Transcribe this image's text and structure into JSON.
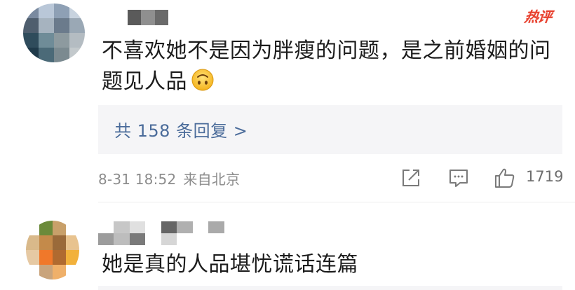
{
  "comments": [
    {
      "badge": "热评",
      "text": "不喜欢她不是因为胖瘦的问题，是之前婚姻的问题见人品",
      "emoji": "upside-down-face",
      "replies_label": "共 158 条回复 >",
      "time": "8-31 18:52",
      "location": "来自北京",
      "likes": "1719"
    },
    {
      "text": "她是真的人品堪忧谎话连篇"
    }
  ],
  "colors": {
    "accent_red": "#e8412f",
    "link_blue": "#4a6b9a",
    "meta_gray": "#8c8c8c",
    "reply_bg": "#f5f5f7"
  },
  "icons": [
    "share-icon",
    "comment-icon",
    "like-icon",
    "upside-down-face-emoji"
  ]
}
